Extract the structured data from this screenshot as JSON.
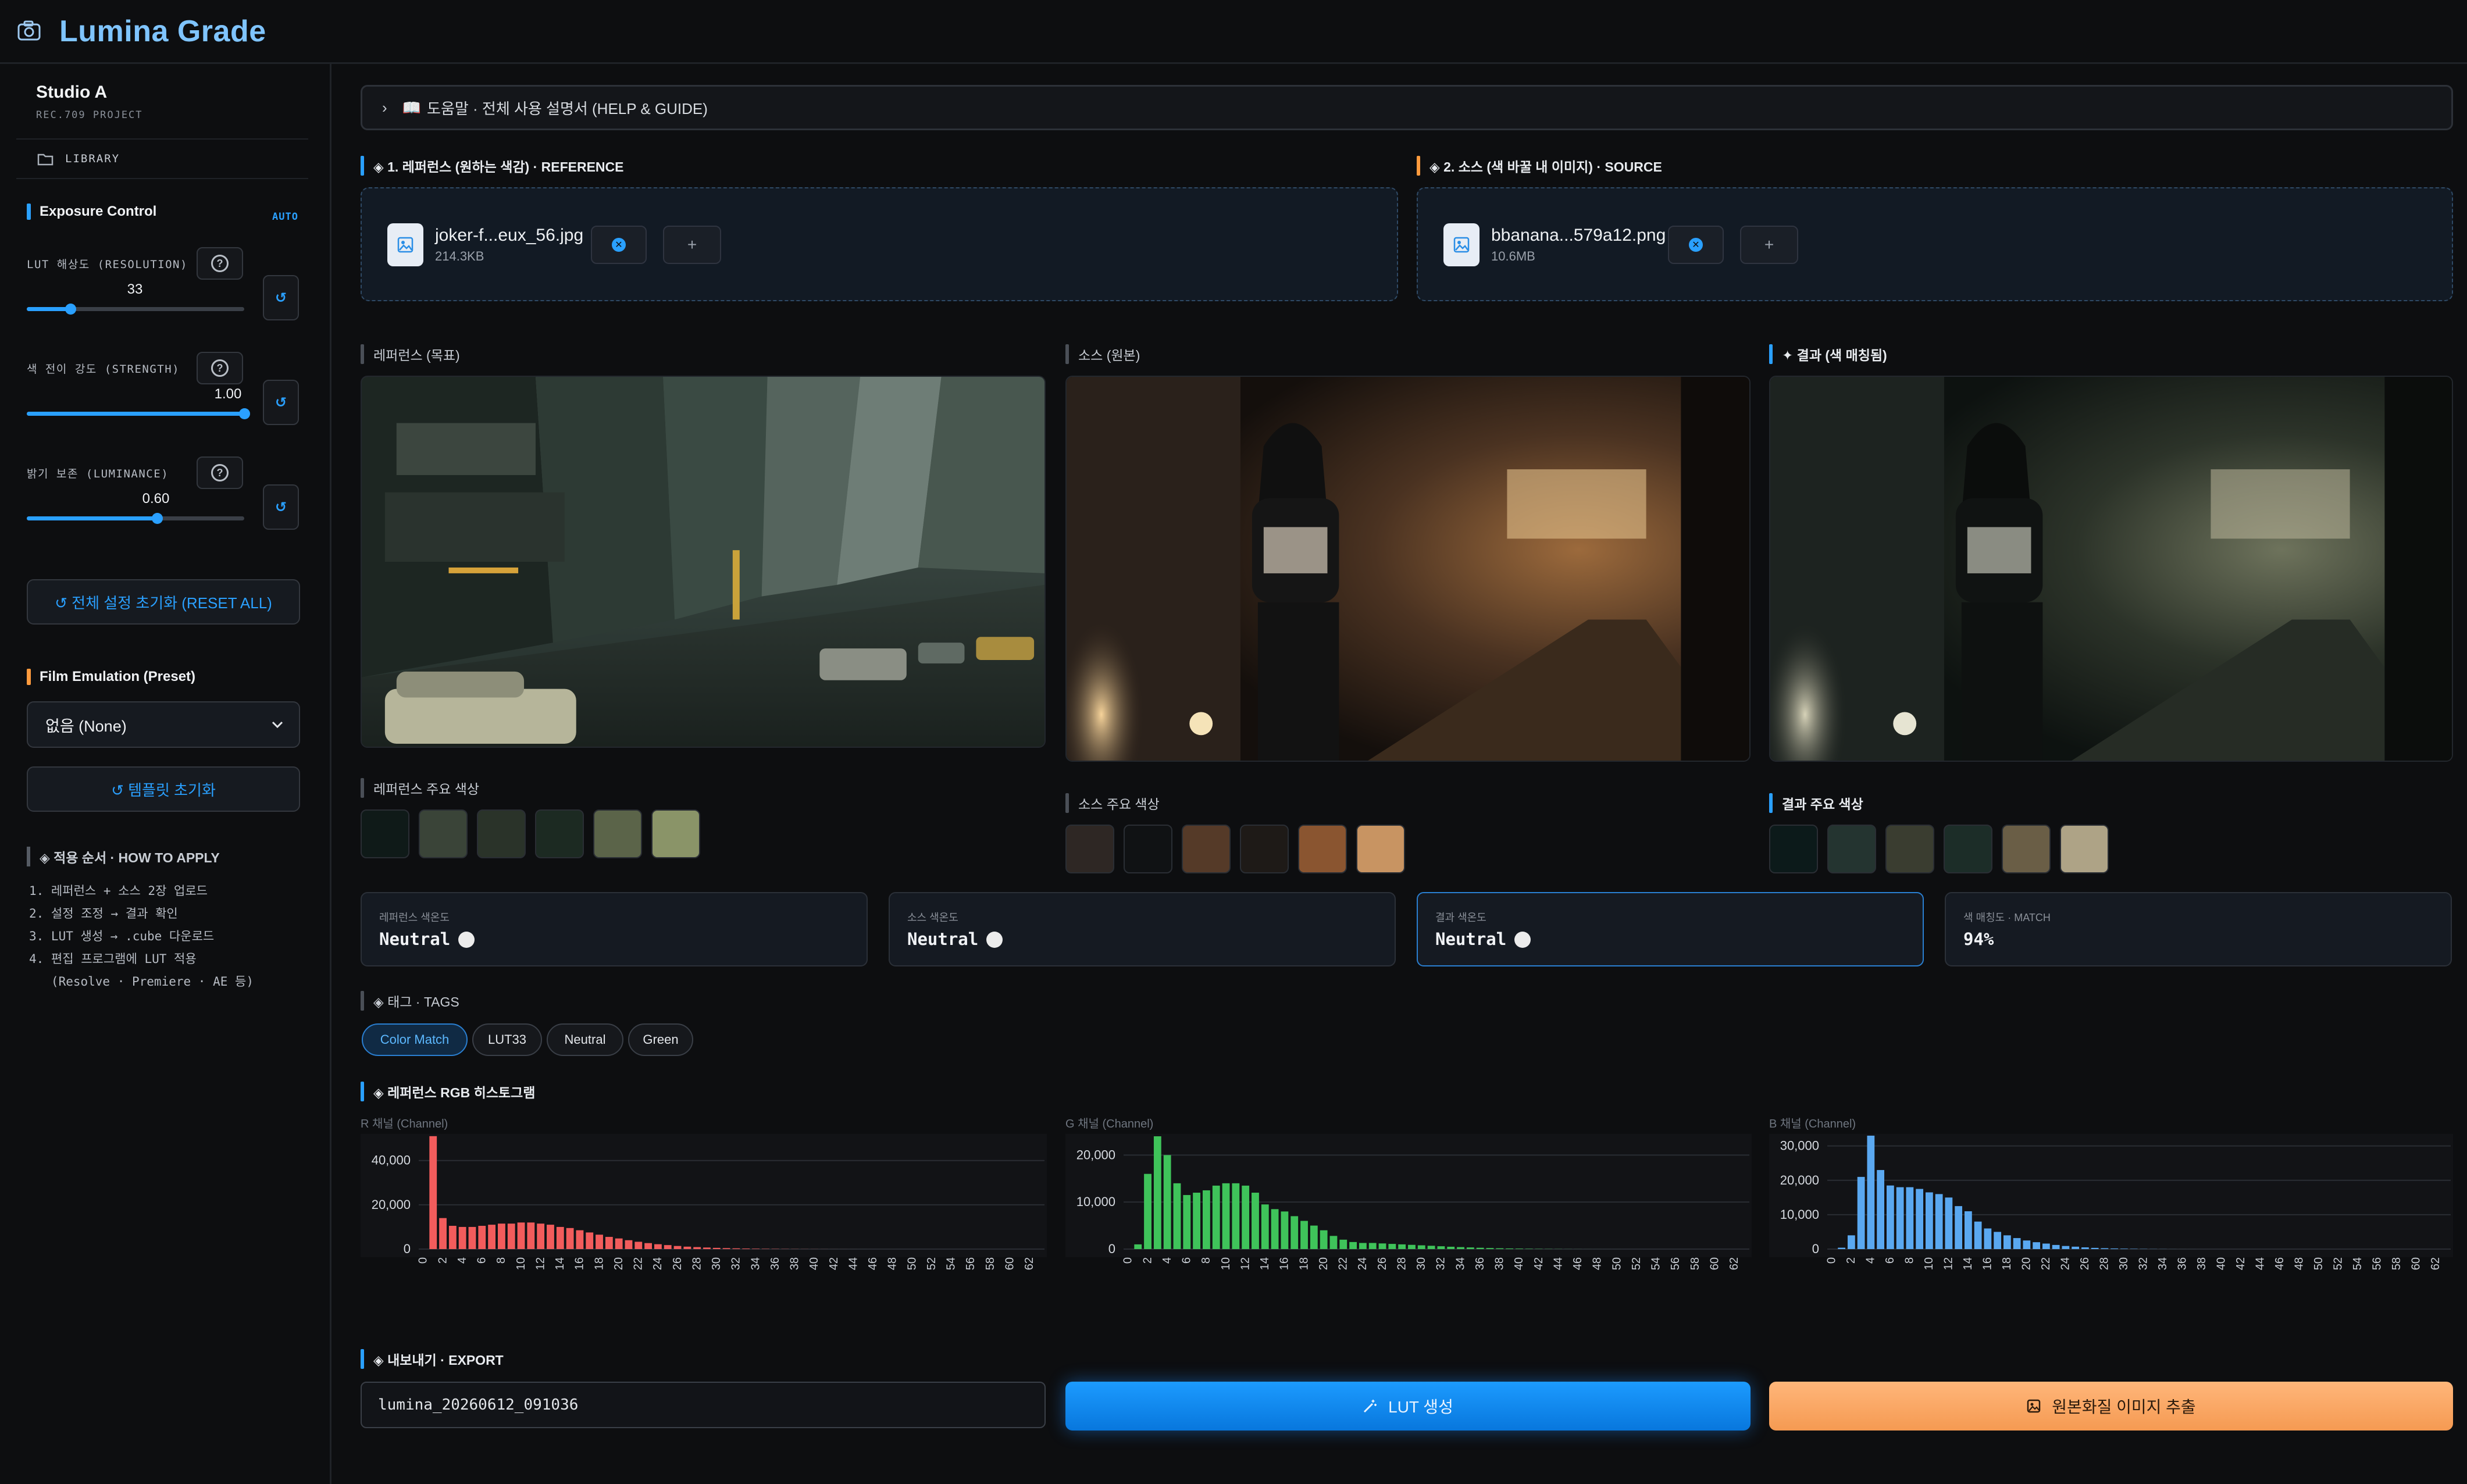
{
  "app": {
    "title": "Lumina Grade"
  },
  "sidebar": {
    "studio_name": "Studio A",
    "studio_sub": "REC.709 PROJECT",
    "library_label": "LIBRARY",
    "exposure_title": "Exposure Control",
    "auto_label": "AUTO",
    "controls": [
      {
        "label": "LUT 해상도 (RESOLUTION)",
        "value": "33",
        "fraction": 0.2
      },
      {
        "label": "색 전이 강도 (STRENGTH)",
        "value": "1.00",
        "fraction": 1.0
      },
      {
        "label": "밝기 보존 (LUMINANCE)",
        "value": "0.60",
        "fraction": 0.6
      }
    ],
    "reset_all_label": "↺ 전체 설정 초기화 (RESET ALL)",
    "film_title": "Film Emulation (Preset)",
    "film_selected": "없음 (None)",
    "template_reset_label": "↺ 템플릿 초기화",
    "howto_title": "◈ 적용 순서 · HOW TO APPLY",
    "howto_steps": [
      "1. 레퍼런스 + 소스 2장 업로드",
      "2. 설정 조정 → 결과 확인",
      "3. LUT 생성 → .cube 다운로드",
      "4. 편집 프로그램에 LUT 적용",
      "   (Resolve · Premiere · AE 등)"
    ]
  },
  "help": {
    "label": "도움말 · 전체 사용 설명서 (HELP & GUIDE)"
  },
  "uploads": {
    "reference": {
      "title": "◈ 1. 레퍼런스 (원하는 색감) · REFERENCE",
      "file_name": "joker-f...eux_56.jpg",
      "file_size": "214.3KB"
    },
    "source": {
      "title": "◈ 2. 소스 (색 바꿀 내 이미지) · SOURCE",
      "file_name": "bbanana...579a12.png",
      "file_size": "10.6MB"
    }
  },
  "previews": {
    "reference_label": "레퍼런스 (목표)",
    "source_label": "소스 (원본)",
    "result_label": "✦ 결과 (색 매칭됨)"
  },
  "palettes": {
    "reference": {
      "label": "레퍼런스 주요 색상",
      "colors": [
        "#0f1a18",
        "#3a4438",
        "#2a3329",
        "#1c2a22",
        "#5b6449",
        "#8a9468"
      ]
    },
    "source": {
      "label": "소스 주요 색상",
      "colors": [
        "#2e2724",
        "#101214",
        "#553a28",
        "#1e1a17",
        "#8a5530",
        "#c89462"
      ]
    },
    "result": {
      "label": "결과 주요 색상",
      "colors": [
        "#0c1a1a",
        "#243430",
        "#3a3d30",
        "#1c2d28",
        "#6a5e46",
        "#aea386"
      ]
    }
  },
  "tones": [
    {
      "label": "레퍼런스 색온도",
      "value": "Neutral"
    },
    {
      "label": "소스 색온도",
      "value": "Neutral"
    },
    {
      "label": "결과 색온도",
      "value": "Neutral"
    },
    {
      "label": "색 매칭도 · MATCH",
      "value": "94%"
    }
  ],
  "tags": {
    "title": "◈ 태그 · TAGS",
    "items": [
      "Color Match",
      "LUT33",
      "Neutral",
      "Green"
    ]
  },
  "histogram": {
    "title": "◈ 레퍼런스 RGB 히스토그램",
    "x_ticks": [
      "0",
      "2",
      "4",
      "6",
      "8",
      "10",
      "12",
      "14",
      "16",
      "18",
      "20",
      "22",
      "24",
      "26",
      "28",
      "30",
      "32",
      "34",
      "36",
      "38",
      "40",
      "42",
      "44",
      "46",
      "48",
      "50",
      "52",
      "54",
      "56",
      "58",
      "60",
      "62"
    ]
  },
  "chart_data": [
    {
      "type": "bar",
      "title": "R 채널 (Channel)",
      "color": "#f25c5c",
      "ylim": [
        0,
        52000
      ],
      "yticks": [
        "0",
        "20,000",
        "40,000"
      ],
      "ytick_values": [
        0,
        20000,
        40000
      ],
      "x": [
        0,
        1,
        2,
        3,
        4,
        5,
        6,
        7,
        8,
        9,
        10,
        11,
        12,
        13,
        14,
        15,
        16,
        17,
        18,
        19,
        20,
        21,
        22,
        23,
        24,
        25,
        26,
        27,
        28,
        29,
        30,
        31,
        32,
        33,
        34,
        35,
        36,
        37,
        38,
        39,
        40,
        41,
        42,
        43,
        44,
        45,
        46,
        47,
        48,
        49,
        50,
        51,
        52,
        53,
        54,
        55,
        56,
        57,
        58,
        59,
        60,
        61,
        62,
        63
      ],
      "values": [
        0,
        51000,
        14000,
        10500,
        10000,
        10000,
        10500,
        11000,
        11500,
        11500,
        12000,
        12000,
        11500,
        11000,
        10000,
        9500,
        8500,
        7500,
        6500,
        5500,
        4800,
        4000,
        3300,
        2700,
        2200,
        1800,
        1400,
        1100,
        900,
        700,
        550,
        430,
        330,
        250,
        180,
        130,
        100,
        70,
        50,
        35,
        25,
        18,
        12,
        8,
        5,
        3,
        2,
        1,
        1,
        0,
        0,
        0,
        0,
        0,
        0,
        0,
        0,
        0,
        0,
        0,
        0,
        0,
        0,
        0
      ]
    },
    {
      "type": "bar",
      "title": "G 채널 (Channel)",
      "color": "#3fc35a",
      "ylim": [
        0,
        24500
      ],
      "yticks": [
        "0",
        "10,000",
        "20,000"
      ],
      "ytick_values": [
        0,
        10000,
        20000
      ],
      "x": [
        0,
        1,
        2,
        3,
        4,
        5,
        6,
        7,
        8,
        9,
        10,
        11,
        12,
        13,
        14,
        15,
        16,
        17,
        18,
        19,
        20,
        21,
        22,
        23,
        24,
        25,
        26,
        27,
        28,
        29,
        30,
        31,
        32,
        33,
        34,
        35,
        36,
        37,
        38,
        39,
        40,
        41,
        42,
        43,
        44,
        45,
        46,
        47,
        48,
        49,
        50,
        51,
        52,
        53,
        54,
        55,
        56,
        57,
        58,
        59,
        60,
        61,
        62,
        63
      ],
      "values": [
        0,
        1000,
        16000,
        24000,
        20000,
        14000,
        11500,
        12000,
        12500,
        13500,
        14000,
        14000,
        13500,
        12000,
        9500,
        8500,
        8000,
        7000,
        6000,
        5000,
        4000,
        2800,
        2000,
        1500,
        1300,
        1300,
        1200,
        1100,
        1000,
        900,
        800,
        700,
        600,
        500,
        420,
        350,
        280,
        220,
        170,
        130,
        100,
        70,
        50,
        35,
        25,
        15,
        10,
        5,
        3,
        2,
        1,
        0,
        0,
        0,
        0,
        0,
        0,
        0,
        0,
        0,
        0,
        0,
        0,
        0
      ]
    },
    {
      "type": "bar",
      "title": "B 채널 (Channel)",
      "color": "#5aa8f0",
      "ylim": [
        0,
        33500
      ],
      "yticks": [
        "0",
        "10,000",
        "20,000",
        "30,000"
      ],
      "ytick_values": [
        0,
        10000,
        20000,
        30000
      ],
      "x": [
        0,
        1,
        2,
        3,
        4,
        5,
        6,
        7,
        8,
        9,
        10,
        11,
        12,
        13,
        14,
        15,
        16,
        17,
        18,
        19,
        20,
        21,
        22,
        23,
        24,
        25,
        26,
        27,
        28,
        29,
        30,
        31,
        32,
        33,
        34,
        35,
        36,
        37,
        38,
        39,
        40,
        41,
        42,
        43,
        44,
        45,
        46,
        47,
        48,
        49,
        50,
        51,
        52,
        53,
        54,
        55,
        56,
        57,
        58,
        59,
        60,
        61,
        62,
        63
      ],
      "values": [
        0,
        400,
        4000,
        21000,
        33000,
        23000,
        18500,
        18000,
        18000,
        17500,
        16500,
        16000,
        15000,
        12500,
        11000,
        8000,
        6000,
        5000,
        4000,
        3200,
        2500,
        2000,
        1600,
        1200,
        900,
        700,
        500,
        350,
        250,
        180,
        120,
        80,
        50,
        30,
        20,
        10,
        5,
        3,
        1,
        0,
        0,
        0,
        0,
        0,
        0,
        0,
        0,
        0,
        0,
        0,
        0,
        0,
        0,
        0,
        0,
        0,
        0,
        0,
        0,
        0,
        0,
        0,
        0,
        0
      ]
    }
  ],
  "export": {
    "title": "◈ 내보내기 · EXPORT",
    "filename": "lumina_20260612_091036",
    "lut_button": "LUT 생성",
    "export_button": "원본화질 이미지 추출"
  }
}
